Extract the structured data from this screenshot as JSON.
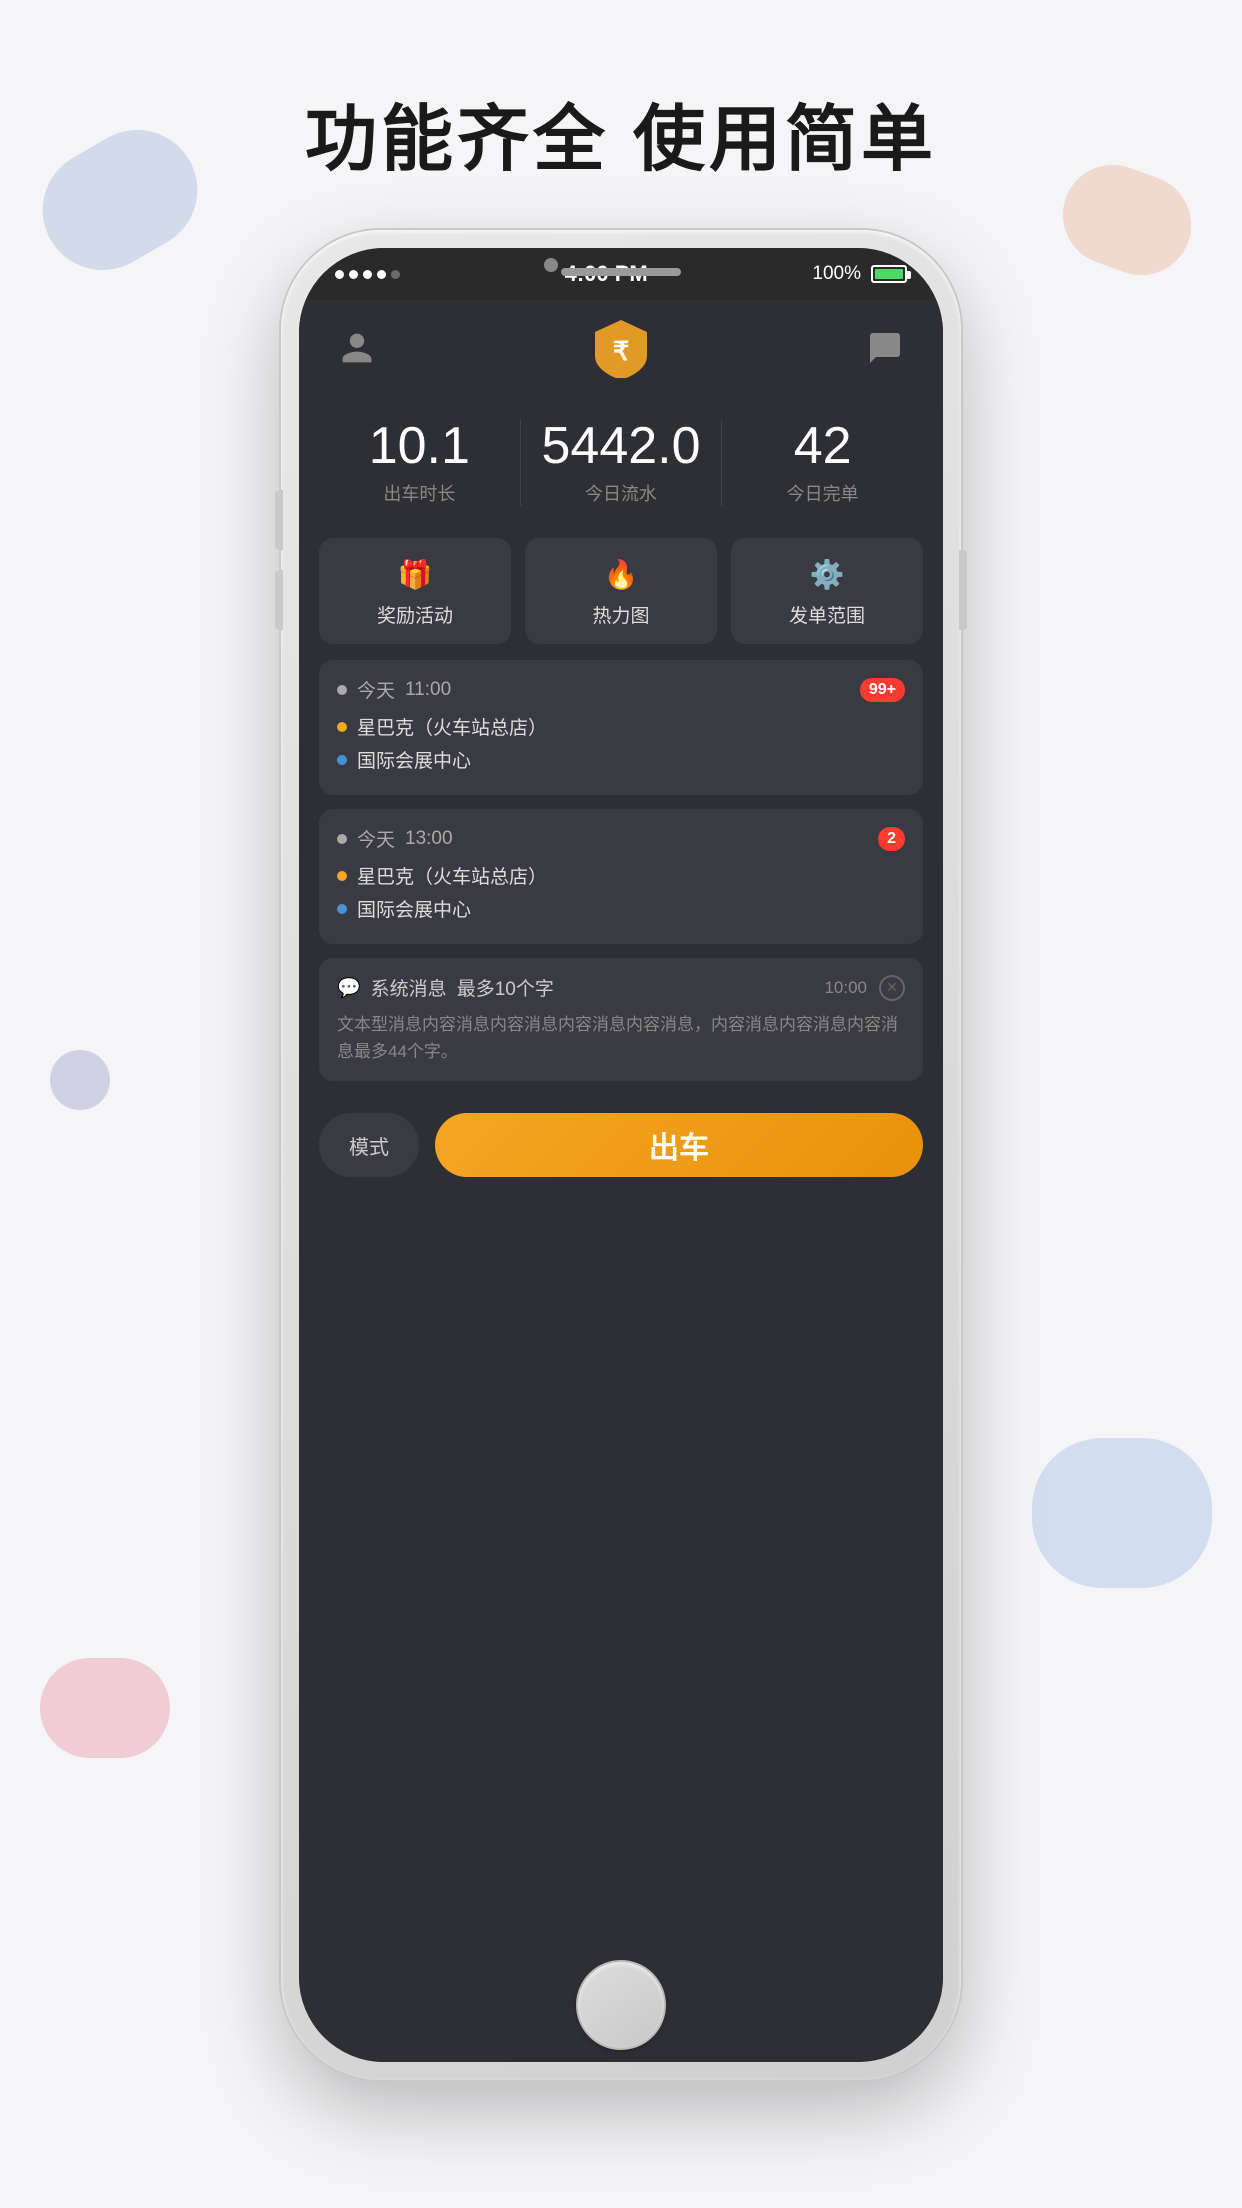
{
  "page": {
    "title": "功能齐全  使用简单"
  },
  "status_bar": {
    "signal_dots": 4,
    "time": "4:00 PM",
    "battery_percent": "100%"
  },
  "nav": {
    "person_icon": "person",
    "logo_icon": "logo",
    "chat_icon": "chat"
  },
  "stats": [
    {
      "value": "10.1",
      "label": "出车时长"
    },
    {
      "value": "5442.0",
      "label": "今日流水"
    },
    {
      "value": "42",
      "label": "今日完单"
    }
  ],
  "quick_actions": [
    {
      "icon": "🎁",
      "label": "奖励活动"
    },
    {
      "icon": "🔥",
      "label": "热力图"
    },
    {
      "icon": "⚙️",
      "label": "发单范围"
    }
  ],
  "orders": [
    {
      "today": "今天",
      "time": "11:00",
      "badge": "99+",
      "from": "星巴克（火车站总店）",
      "to": "国际会展中心"
    },
    {
      "today": "今天",
      "time": "13:00",
      "badge": "2",
      "from": "星巴克（火车站总店）",
      "to": "国际会展中心"
    }
  ],
  "message": {
    "icon": "💬",
    "title": "系统消息",
    "subtitle": "最多10个字",
    "time": "10:00",
    "body": "文本型消息内容消息内容消息内容消息内容消息，内容消息内容消息内容消息最多44个字。"
  },
  "bottom_bar": {
    "mode_label": "模式",
    "go_label": "出车"
  }
}
